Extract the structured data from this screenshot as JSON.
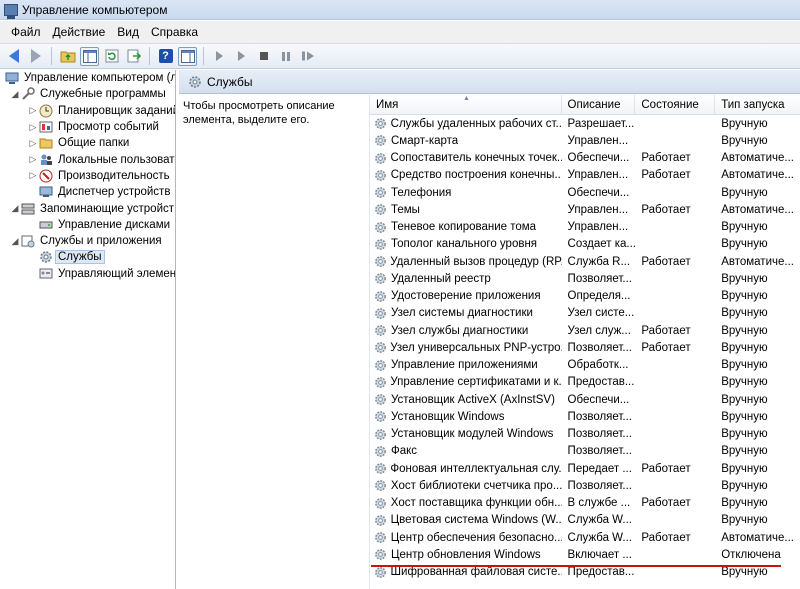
{
  "window": {
    "title": "Управление компьютером"
  },
  "menu": [
    "Файл",
    "Действие",
    "Вид",
    "Справка"
  ],
  "toolbar": {
    "buttons": [
      "back-icon",
      "forward-icon",
      "up-folder-icon",
      "show-hide-tree-icon",
      "refresh-icon",
      "export-icon",
      "help-icon",
      "show-hide-action-icon",
      "start-service-icon",
      "start-service-alt-icon",
      "stop-service-icon",
      "pause-service-icon",
      "restart-service-icon"
    ]
  },
  "tree": {
    "root": "Управление компьютером (л",
    "items": [
      {
        "label": "Служебные программы",
        "level": 1,
        "expander": "◢",
        "icon": "tools-icon"
      },
      {
        "label": "Планировщик заданий",
        "level": 2,
        "expander": "▷",
        "icon": "clock-icon"
      },
      {
        "label": "Просмотр событий",
        "level": 2,
        "expander": "▷",
        "icon": "event-viewer-icon"
      },
      {
        "label": "Общие папки",
        "level": 2,
        "expander": "▷",
        "icon": "folder-icon"
      },
      {
        "label": "Локальные пользовате",
        "level": 2,
        "expander": "▷",
        "icon": "users-icon"
      },
      {
        "label": "Производительность",
        "level": 2,
        "expander": "▷",
        "icon": "performance-icon"
      },
      {
        "label": "Диспетчер устройств",
        "level": 2,
        "expander": "",
        "icon": "device-manager-icon"
      },
      {
        "label": "Запоминающие устройст",
        "level": 1,
        "expander": "◢",
        "icon": "storage-icon"
      },
      {
        "label": "Управление дисками",
        "level": 2,
        "expander": "",
        "icon": "disk-icon"
      },
      {
        "label": "Службы и приложения",
        "level": 1,
        "expander": "◢",
        "icon": "services-apps-icon"
      },
      {
        "label": "Службы",
        "level": 2,
        "expander": "",
        "icon": "services-icon",
        "selected": true
      },
      {
        "label": "Управляющий элемен",
        "level": 2,
        "expander": "",
        "icon": "wmi-icon"
      }
    ]
  },
  "main": {
    "header": "Службы",
    "description": "Чтобы просмотреть описание элемента, выделите его.",
    "columns": [
      "Имя",
      "Описание",
      "Состояние",
      "Тип запуска"
    ],
    "rows": [
      [
        "Службы удаленных рабочих ст...",
        "Разрешает...",
        "",
        "Вручную"
      ],
      [
        "Смарт-карта",
        "Управлен...",
        "",
        "Вручную"
      ],
      [
        "Сопоставитель конечных точек...",
        "Обеспечи...",
        "Работает",
        "Автоматиче..."
      ],
      [
        "Средство построения конечны...",
        "Управлен...",
        "Работает",
        "Автоматиче..."
      ],
      [
        "Телефония",
        "Обеспечи...",
        "",
        "Вручную"
      ],
      [
        "Темы",
        "Управлен...",
        "Работает",
        "Автоматиче..."
      ],
      [
        "Теневое копирование тома",
        "Управлен...",
        "",
        "Вручную"
      ],
      [
        "Тополог канального уровня",
        "Создает ка...",
        "",
        "Вручную"
      ],
      [
        "Удаленный вызов процедур (RP...",
        "Служба R...",
        "Работает",
        "Автоматиче..."
      ],
      [
        "Удаленный реестр",
        "Позволяет...",
        "",
        "Вручную"
      ],
      [
        "Удостоверение приложения",
        "Определя...",
        "",
        "Вручную"
      ],
      [
        "Узел системы диагностики",
        "Узел систе...",
        "",
        "Вручную"
      ],
      [
        "Узел службы диагностики",
        "Узел служ...",
        "Работает",
        "Вручную"
      ],
      [
        "Узел универсальных PNP-устро...",
        "Позволяет...",
        "Работает",
        "Вручную"
      ],
      [
        "Управление приложениями",
        "Обработк...",
        "",
        "Вручную"
      ],
      [
        "Управление сертификатами и к...",
        "Предостав...",
        "",
        "Вручную"
      ],
      [
        "Установщик ActiveX (AxInstSV)",
        "Обеспечи...",
        "",
        "Вручную"
      ],
      [
        "Установщик Windows",
        "Позволяет...",
        "",
        "Вручную"
      ],
      [
        "Установщик модулей Windows",
        "Позволяет...",
        "",
        "Вручную"
      ],
      [
        "Факс",
        "Позволяет...",
        "",
        "Вручную"
      ],
      [
        "Фоновая интеллектуальная слу...",
        "Передает ...",
        "Работает",
        "Вручную"
      ],
      [
        "Хост библиотеки счетчика про...",
        "Позволяет...",
        "",
        "Вручную"
      ],
      [
        "Хост поставщика функции обн...",
        "В службе ...",
        "Работает",
        "Вручную"
      ],
      [
        "Цветовая система Windows (W...",
        "Служба W...",
        "",
        "Вручную"
      ],
      [
        "Центр обеспечения безопасно...",
        "Служба W...",
        "Работает",
        "Автоматиче..."
      ],
      [
        "Центр обновления Windows",
        "Включает ...",
        "",
        "Отключена"
      ],
      [
        "Шифрованная файловая систе...",
        "Предостав...",
        "",
        "Вручную"
      ]
    ]
  },
  "colors": {
    "highlight": "#d01010",
    "selection": "#dce8f7"
  }
}
